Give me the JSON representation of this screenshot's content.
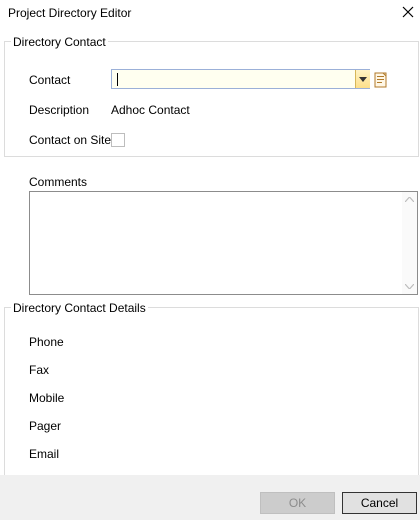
{
  "window": {
    "title": "Project Directory Editor"
  },
  "directory_contact": {
    "legend": "Directory Contact",
    "contact_label": "Contact",
    "contact_value": "",
    "description_label": "Description",
    "description_value": "Adhoc Contact",
    "on_site_label": "Contact on Site",
    "on_site_checked": false
  },
  "comments": {
    "label": "Comments",
    "value": ""
  },
  "details": {
    "legend": "Directory Contact Details",
    "fields": [
      "Phone",
      "Fax",
      "Mobile",
      "Pager",
      "Email"
    ]
  },
  "buttons": {
    "ok": "OK",
    "cancel": "Cancel"
  },
  "icons": {
    "close": "close-icon",
    "dropdown": "chevron-down-icon",
    "lookup": "document-icon"
  }
}
